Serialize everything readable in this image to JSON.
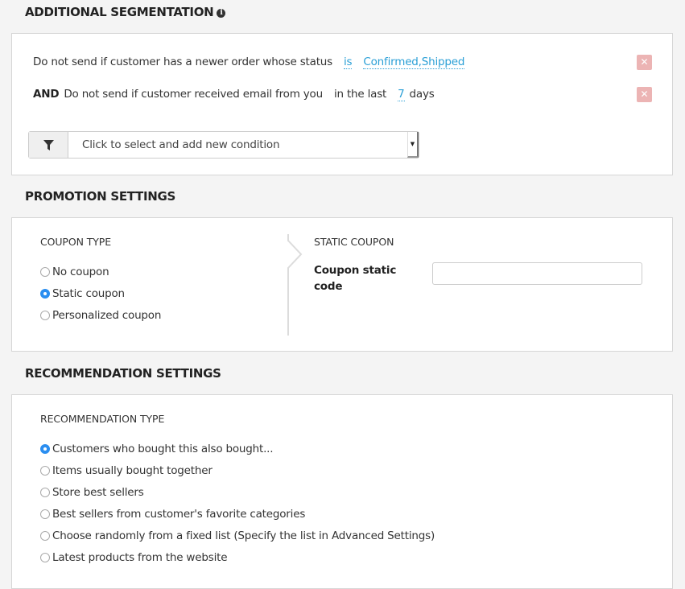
{
  "segmentation": {
    "title": "ADDITIONAL SEGMENTATION",
    "info_icon": "info-circle-icon",
    "conditions": [
      {
        "prefix": "",
        "text": "Do not send if customer has a newer order whose status",
        "operator": "is",
        "value": "Confirmed,Shipped",
        "suffix": "",
        "remove_icon": "close-icon"
      },
      {
        "prefix": "AND",
        "text": "Do not send if customer received email from you",
        "operator": "in the last",
        "value": "7",
        "suffix": "days",
        "remove_icon": "close-icon"
      }
    ],
    "add_condition": {
      "icon": "filter-icon",
      "placeholder": "Click to select and add new condition"
    }
  },
  "promotion": {
    "title": "PROMOTION SETTINGS",
    "coupon_type_label": "COUPON TYPE",
    "coupon_options": [
      {
        "label": "No coupon",
        "checked": false
      },
      {
        "label": "Static coupon",
        "checked": true
      },
      {
        "label": "Personalized coupon",
        "checked": false
      }
    ],
    "static_coupon_label": "STATIC COUPON",
    "coupon_code_label_line1": "Coupon static",
    "coupon_code_label_line2": "code",
    "coupon_code_value": ""
  },
  "recommendation": {
    "title": "RECOMMENDATION SETTINGS",
    "type_label": "RECOMMENDATION TYPE",
    "options": [
      {
        "label": "Customers who bought this also bought...",
        "checked": true
      },
      {
        "label": "Items usually bought together",
        "checked": false
      },
      {
        "label": "Store best sellers",
        "checked": false
      },
      {
        "label": "Best sellers from customer's favorite categories",
        "checked": false
      },
      {
        "label": "Choose randomly from a fixed list (Specify the list in Advanced Settings)",
        "checked": false
      },
      {
        "label": "Latest products from the website",
        "checked": false
      }
    ]
  },
  "colors": {
    "link": "#2a9fd6",
    "radio_checked": "#2b8ef0",
    "remove_button": "#ecb4b4",
    "page_background": "#f4f4f4"
  }
}
